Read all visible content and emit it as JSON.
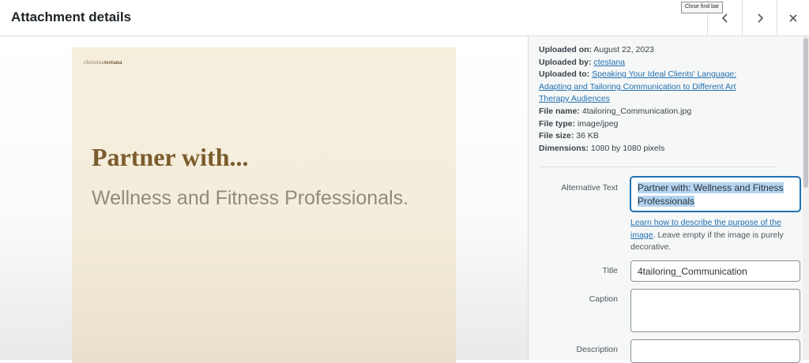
{
  "header": {
    "title": "Attachment details",
    "tooltip": "Close find bar",
    "prev_icon": "chevron-left-icon",
    "next_icon": "chevron-right-icon",
    "close_icon": "close-icon"
  },
  "preview": {
    "brand_light": "christina",
    "brand_bold": "testana",
    "headline": "Partner with...",
    "subheadline": "Wellness and Fitness Professionals."
  },
  "details": {
    "uploaded_on_label": "Uploaded on:",
    "uploaded_on": "August 22, 2023",
    "uploaded_by_label": "Uploaded by:",
    "uploaded_by": "ctestana",
    "uploaded_to_label": "Uploaded to:",
    "uploaded_to_line1": "Speaking Your Ideal Clients' Language:",
    "uploaded_to_line2": "Adapting and Tailoring Communication to Different Art",
    "uploaded_to_line3": "Therapy Audiences",
    "file_name_label": "File name:",
    "file_name": "4tailoring_Communication.jpg",
    "file_type_label": "File type:",
    "file_type": "image/jpeg",
    "file_size_label": "File size:",
    "file_size": "36 KB",
    "dimensions_label": "Dimensions:",
    "dimensions": "1080 by 1080 pixels"
  },
  "form": {
    "alt_label": "Alternative Text",
    "alt_value": "Partner with: Wellness and Fitness Professionals",
    "alt_help_link_1": "Learn how to describe the purpose of the",
    "alt_help_link_2": "image",
    "alt_help_text": ". Leave empty if the image is purely decorative.",
    "title_label": "Title",
    "title_value": "4tailoring_Communication",
    "caption_label": "Caption",
    "caption_value": "",
    "description_label": "Description",
    "description_value": ""
  },
  "colors": {
    "link": "#2271b1",
    "headline": "#7a5c2d",
    "artwork_bg": "#f6eedc",
    "selection": "#b3d3f0"
  }
}
